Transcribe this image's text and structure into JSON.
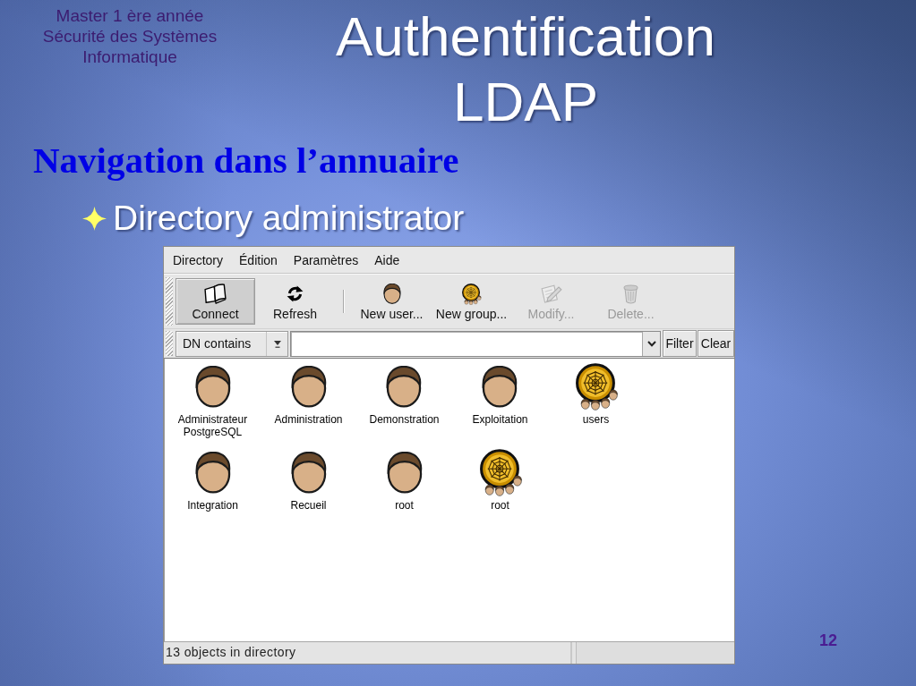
{
  "slide": {
    "course_label": [
      "Master 1 ère année",
      "Sécurité des Systèmes",
      "Informatique"
    ],
    "title": "Authentification LDAP",
    "heading": "Navigation dans l’annuaire",
    "bullets": [
      "Directory administrator"
    ],
    "page_number": "12"
  },
  "window": {
    "menu": [
      "Directory",
      "Édition",
      "Paramètres",
      "Aide"
    ],
    "toolbar": {
      "groups": [
        [
          {
            "label": "Connect",
            "active": true,
            "disabled": false
          },
          {
            "label": "Refresh",
            "active": false,
            "disabled": false
          }
        ],
        [
          {
            "label": "New user...",
            "active": false,
            "disabled": false
          },
          {
            "label": "New group...",
            "active": false,
            "disabled": false
          },
          {
            "label": "Modify...",
            "active": false,
            "disabled": true
          },
          {
            "label": "Delete...",
            "active": false,
            "disabled": true
          }
        ]
      ]
    },
    "filter_bar": {
      "match_mode": "DN contains",
      "buttons": [
        "Filter",
        "Clear"
      ]
    },
    "entries": [
      {
        "label": "Administrateur PostgreSQL",
        "kind": "user"
      },
      {
        "label": "Administration",
        "kind": "user"
      },
      {
        "label": "Demonstration",
        "kind": "user"
      },
      {
        "label": "Exploitation",
        "kind": "user"
      },
      {
        "label": "users",
        "kind": "group"
      },
      {
        "label": "Integration",
        "kind": "user"
      },
      {
        "label": "Recueil",
        "kind": "user"
      },
      {
        "label": "root",
        "kind": "user"
      },
      {
        "label": "root",
        "kind": "group"
      }
    ],
    "status_bar": {
      "message": "13 objects in directory"
    }
  }
}
